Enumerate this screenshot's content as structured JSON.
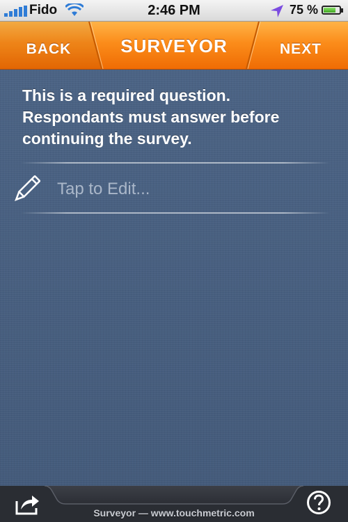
{
  "status_bar": {
    "carrier": "Fido",
    "time": "2:46 PM",
    "battery_percent": "75 %",
    "battery_level": 0.75,
    "icons": [
      "signal-icon",
      "wifi-icon",
      "location-arrow-icon",
      "battery-icon"
    ]
  },
  "nav_bar": {
    "back_label": "BACK",
    "title": "SURVEYOR",
    "next_label": "NEXT",
    "accent_color": "#f7801a"
  },
  "question": {
    "text": "This is a required question. Respondants must answer before continuing the survey."
  },
  "answer": {
    "placeholder": "Tap to Edit...",
    "value": "",
    "icon": "pencil-icon"
  },
  "toolbar": {
    "footer_text": "Surveyor — www.touchmetric.com",
    "share_icon": "share-icon",
    "help_icon": "help-icon"
  }
}
